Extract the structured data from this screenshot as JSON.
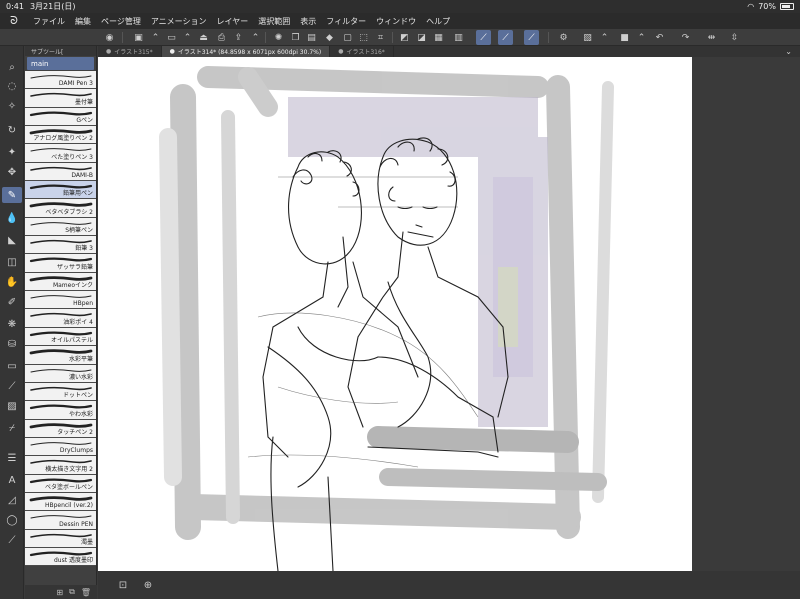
{
  "status_bar": {
    "time": "0:41",
    "date": "3月21日(日)",
    "battery": "70%",
    "battery_level": 0.7
  },
  "menu": {
    "items": [
      "ファイル",
      "編集",
      "ページ管理",
      "アニメーション",
      "レイヤー",
      "選択範囲",
      "表示",
      "フィルター",
      "ウィンドウ",
      "ヘルプ"
    ]
  },
  "subtool_panel": {
    "title": "サブツール[",
    "group": "main",
    "brushes": [
      "DAMI Pen 3",
      "墨付筆",
      "Gペン",
      "アナログ風塗りペン 2",
      "べた塗りペン 3",
      "DAMI-B",
      "鉛筆用ペン",
      "ベタベタブラシ 2",
      "S柄筆ペン",
      "鉛筆 3",
      "ザッサラ鉛筆",
      "Mameoインク",
      "HBpen",
      "油彩ポイ 4",
      "オイルパステル",
      "水彩平筆",
      "濃い水彩",
      "ドットペン",
      "やわ水彩",
      "タッチペン 2",
      "DryClumps",
      "横太描き文字用 2",
      "ベタ塗ボールペン",
      "HBpencil (ver.2)",
      "Dessin PEN",
      "濁墨",
      "dust 透度墨印"
    ],
    "selected_index": 6
  },
  "tabs": [
    {
      "label": "イラスト315*",
      "active": false
    },
    {
      "label": "イラスト314* (84.8598 x 6071px 600dpi 30.7%)",
      "active": true
    },
    {
      "label": "イラスト316*",
      "active": false
    }
  ],
  "colors": {
    "main": "#1c3ed8",
    "sub": "#111111",
    "accent": "#5a6f9a"
  }
}
